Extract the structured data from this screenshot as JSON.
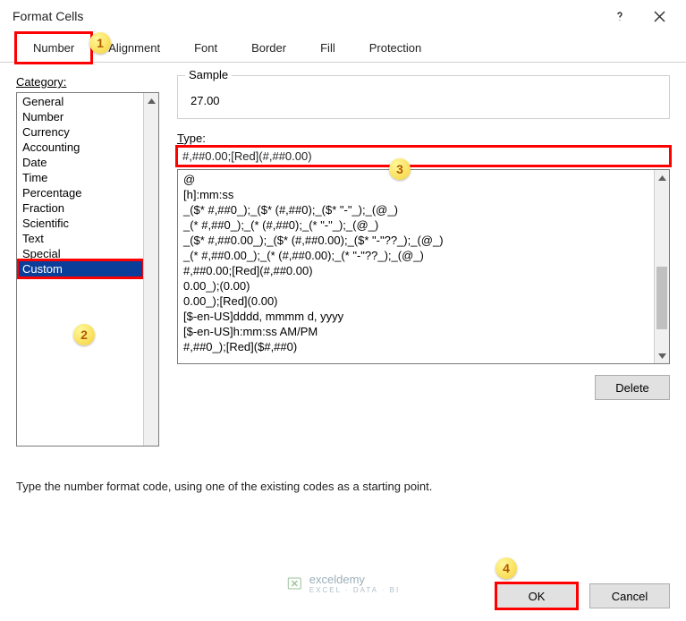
{
  "title": "Format Cells",
  "tabs": [
    {
      "label": "Number",
      "active": true
    },
    {
      "label": "Alignment",
      "active": false
    },
    {
      "label": "Font",
      "active": false
    },
    {
      "label": "Border",
      "active": false
    },
    {
      "label": "Fill",
      "active": false
    },
    {
      "label": "Protection",
      "active": false
    }
  ],
  "category_label": "Category:",
  "categories": [
    "General",
    "Number",
    "Currency",
    "Accounting",
    "Date",
    "Time",
    "Percentage",
    "Fraction",
    "Scientific",
    "Text",
    "Special",
    "Custom"
  ],
  "selected_category_index": 11,
  "sample_label": "Sample",
  "sample_value": "27.00",
  "type_label": "Type:",
  "type_value": "#,##0.00;[Red](#,##0.00)",
  "format_codes": [
    "@",
    "[h]:mm:ss",
    "_($* #,##0_);_($* (#,##0);_($* \"-\"_);_(@_)",
    "_(* #,##0_);_(* (#,##0);_(* \"-\"_);_(@_)",
    "_($* #,##0.00_);_($* (#,##0.00);_($* \"-\"??_);_(@_)",
    "_(* #,##0.00_);_(* (#,##0.00);_(* \"-\"??_);_(@_)",
    "#,##0.00;[Red](#,##0.00)",
    "0.00_);(0.00)",
    "0.00_);[Red](0.00)",
    "[$-en-US]dddd, mmmm d, yyyy",
    "[$-en-US]h:mm:ss AM/PM",
    "#,##0_);[Red]($#,##0)"
  ],
  "delete_label": "Delete",
  "hint": "Type the number format code, using one of the existing codes as a starting point.",
  "ok_label": "OK",
  "cancel_label": "Cancel",
  "watermark": {
    "brand": "exceldemy",
    "sub": "EXCEL · DATA · BI"
  },
  "callouts": {
    "c1": "1",
    "c2": "2",
    "c3": "3",
    "c4": "4"
  }
}
